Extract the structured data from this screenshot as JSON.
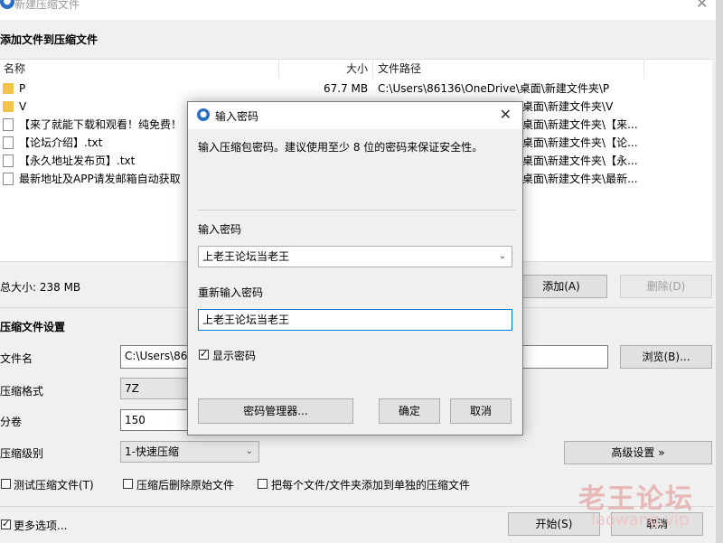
{
  "window": {
    "title": "新建压缩文件"
  },
  "files_section": {
    "heading": "添加文件到压缩文件",
    "columns": {
      "name": "名称",
      "size": "大小",
      "path": "文件路径"
    },
    "rows": [
      {
        "icon": "folder-icon",
        "name": "P",
        "size": "67.7 MB",
        "path": "C:\\Users\\86136\\OneDrive\\桌面\\新建文件夹\\P"
      },
      {
        "icon": "folder-icon",
        "name": "V",
        "size": "",
        "path": "桌面\\新建文件夹\\V"
      },
      {
        "icon": "document-icon",
        "name": "【来了就能下载和观看！纯免费！",
        "size": "",
        "path": "桌面\\新建文件夹\\【来..."
      },
      {
        "icon": "document-icon",
        "name": "【论坛介绍】.txt",
        "size": "",
        "path": "桌面\\新建文件夹\\【论..."
      },
      {
        "icon": "document-icon",
        "name": "【永久地址发布页】.txt",
        "size": "",
        "path": "桌面\\新建文件夹\\【永..."
      },
      {
        "icon": "document-icon",
        "name": "最新地址及APP请发邮箱自动获取",
        "size": "",
        "path": "桌面\\新建文件夹\\最新..."
      }
    ],
    "total_size": "总大小: 238 MB",
    "add_button": "添加(A)",
    "delete_button": "删除(D)"
  },
  "settings": {
    "heading": "压缩文件设置",
    "filename_label": "文件名",
    "filename_value": "C:\\Users\\86",
    "browse_button": "浏览(B)...",
    "format_label": "压缩格式",
    "format_value": "7Z",
    "split_label": "分卷",
    "split_value": "150",
    "level_label": "压缩级别",
    "level_value": "1-快速压缩",
    "advanced_button": "高级设置 »",
    "test_checkbox": "测试压缩文件(T)",
    "delete_after_checkbox": "压缩后删除原始文件",
    "separate_checkbox": "把每个文件/文件夹添加到单独的压缩文件",
    "more_options": "更多选项...",
    "start_button": "开始(S)",
    "cancel_button": "取消"
  },
  "dialog": {
    "title": "输入密码",
    "description": "输入压缩包密码。建议使用至少 8 位的密码来保证安全性。",
    "password_label": "输入密码",
    "password_value": "上老王论坛当老王",
    "confirm_label": "重新输入密码",
    "confirm_value": "上老王论坛当老王",
    "show_password": "显示密码",
    "manager_button": "密码管理器...",
    "ok_button": "确定",
    "cancel_button": "取消"
  },
  "watermark": {
    "text": "老王论坛",
    "url": "laowang.vip"
  }
}
